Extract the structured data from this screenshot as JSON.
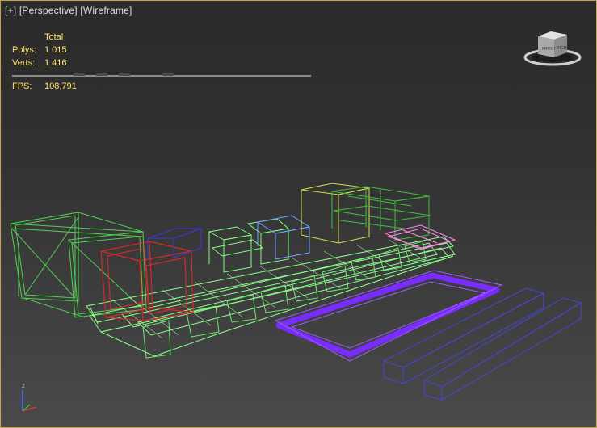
{
  "viewport": {
    "label": {
      "plus": "[+]",
      "view": "[Perspective]",
      "shading": "[Wireframe]"
    },
    "stats": {
      "header": "Total",
      "polys_label": "Polys:",
      "polys_value": "1 015",
      "verts_label": "Verts:",
      "verts_value": "1 416",
      "fps_label": "FPS:",
      "fps_value": "108,791"
    },
    "viewcube_icon": "viewcube-icon",
    "axis_tripod": {
      "z_label": "z"
    }
  },
  "colors": {
    "border": "#c7a64a",
    "stats_text": "#ffe46a",
    "wire_green": "#7dff7d",
    "wire_dark_green": "#3fbf3f",
    "wire_red": "#d22a2a",
    "wire_blue": "#4646d8",
    "wire_purple": "#7a2cff",
    "wire_pink": "#ff8ce6",
    "wire_yellow": "#d8d85a",
    "wire_sky": "#6fa0ff"
  }
}
